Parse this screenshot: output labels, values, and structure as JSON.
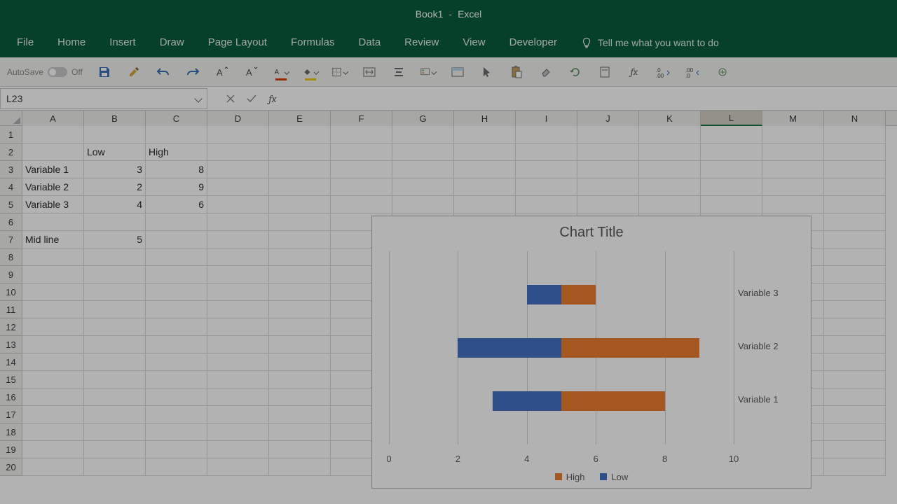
{
  "window": {
    "doc": "Book1",
    "app": "Excel"
  },
  "tabs": [
    "File",
    "Home",
    "Insert",
    "Draw",
    "Page Layout",
    "Formulas",
    "Data",
    "Review",
    "View",
    "Developer"
  ],
  "tell_me": "Tell me what you want to do",
  "autosave": {
    "label": "AutoSave",
    "state": "Off"
  },
  "namebox": "L23",
  "formula": "",
  "columns": [
    "A",
    "B",
    "C",
    "D",
    "E",
    "F",
    "G",
    "H",
    "I",
    "J",
    "K",
    "L",
    "M",
    "N"
  ],
  "selected_col_index": 11,
  "row_count": 20,
  "cells": {
    "B2": "Low",
    "C2": "High",
    "A3": "Variable 1",
    "B3": "3",
    "C3": "8",
    "A4": "Variable 2",
    "B4": "2",
    "C4": "9",
    "A5": "Variable 3",
    "B5": "4",
    "C5": "6",
    "A7": "Mid line",
    "B7": "5"
  },
  "chart_data": {
    "type": "bar",
    "title": "Chart Title",
    "categories": [
      "Variable 1",
      "Variable 2",
      "Variable 3"
    ],
    "series": [
      {
        "name": "High",
        "color": "#ed7d31",
        "values": [
          8,
          9,
          6
        ]
      },
      {
        "name": "Low",
        "color": "#4472c4",
        "values": [
          3,
          2,
          4
        ]
      }
    ],
    "midline": 5,
    "xaxis": {
      "min": 0,
      "max": 10,
      "ticks": [
        0,
        2,
        4,
        6,
        8,
        10
      ]
    },
    "orientation": "horizontal-diverging",
    "legend": [
      "High",
      "Low"
    ]
  }
}
